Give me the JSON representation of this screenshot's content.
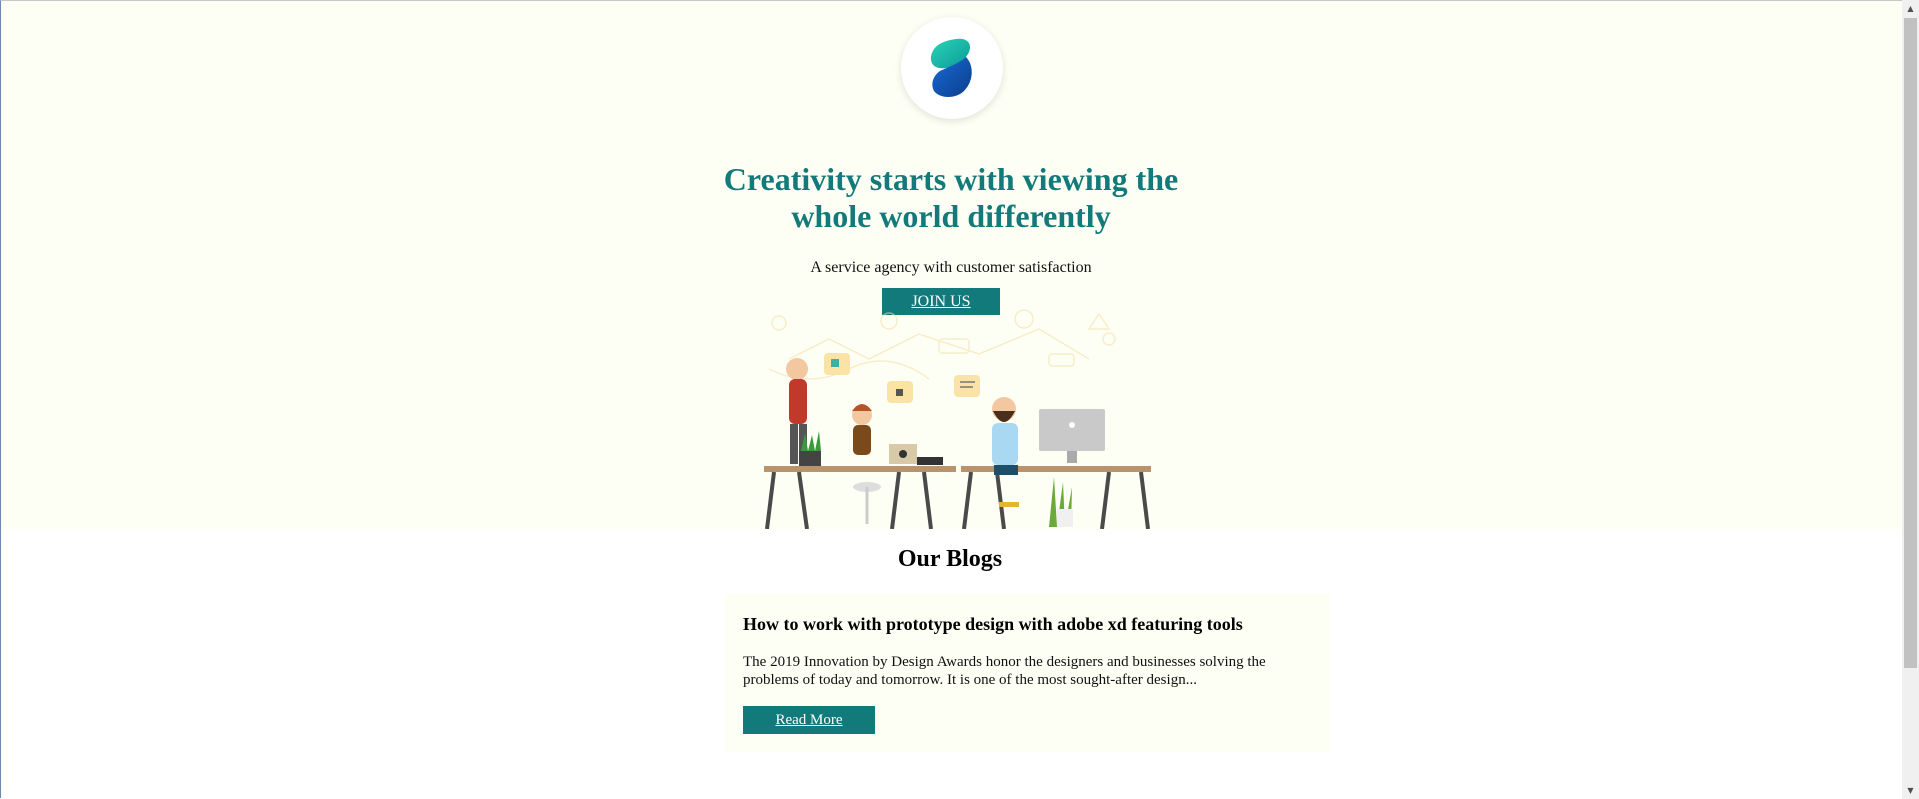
{
  "hero": {
    "title_line1": "Creativity starts with viewing the",
    "title_line2": "whole world differently",
    "subtitle": "A service agency with customer satisfaction",
    "cta_label": "JOIN US"
  },
  "blogs": {
    "section_title": "Our Blogs",
    "items": [
      {
        "title": "How to work with prototype design with adobe xd featuring tools",
        "excerpt": "The 2019 Innovation by Design Awards honor the designers and businesses solving the problems of today and tomorrow. It is one of the most sought-after design...",
        "button_label": "Read More"
      }
    ]
  },
  "colors": {
    "accent": "#137a7b",
    "hero_bg": "#fefff4",
    "card_bg": "#fefff4"
  },
  "icons": {
    "logo": "brand-logo-icon",
    "illustration": "team-workspace-illustration"
  }
}
